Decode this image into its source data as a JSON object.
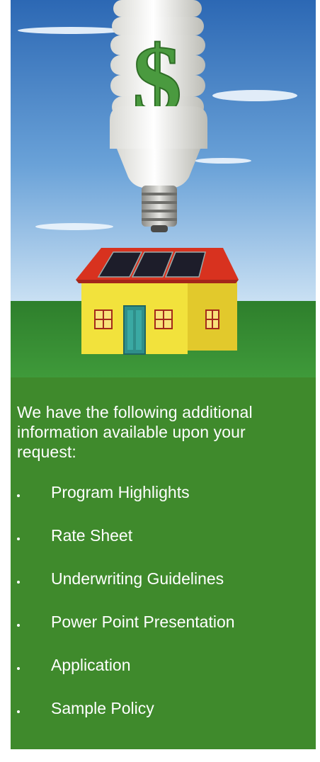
{
  "hero": {
    "image": "cfl-bulb-dollar-over-solar-house-illustration"
  },
  "intro_text": "We have the following additional information available upon your request:",
  "items": [
    {
      "label": "Program Highlights"
    },
    {
      "label": "Rate Sheet"
    },
    {
      "label": "Underwriting Guidelines"
    },
    {
      "label": "Power Point Presentation"
    },
    {
      "label": "Application"
    },
    {
      "label": "Sample Policy"
    }
  ],
  "colors": {
    "panel": "#3f8a2c",
    "sky_top": "#2f6fb8",
    "sky_bottom": "#bcd8f2",
    "grass": "#3a8f35",
    "roof": "#d8321f",
    "house": "#f2e13a",
    "text": "#ffffff"
  }
}
